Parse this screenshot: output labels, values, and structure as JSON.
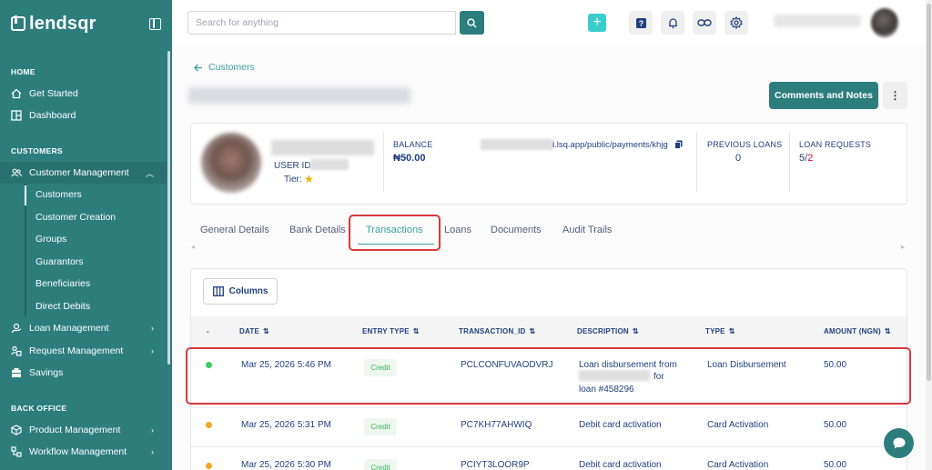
{
  "sidebar": {
    "brand": "lendsqr",
    "sections": {
      "home": "HOME",
      "customers": "CUSTOMERS",
      "back_office": "BACK OFFICE"
    },
    "items": {
      "get_started": "Get Started",
      "dashboard": "Dashboard",
      "customer_management": "Customer Management",
      "loan_management": "Loan Management",
      "request_management": "Request Management",
      "savings": "Savings",
      "product_management": "Product Management",
      "workflow_management": "Workflow Management"
    },
    "sub_items": [
      "Customers",
      "Customer Creation",
      "Groups",
      "Guarantors",
      "Beneficiaries",
      "Direct Debits"
    ]
  },
  "topbar": {
    "search_placeholder": "Search for anything",
    "plus_label": "+"
  },
  "breadcrumb": {
    "back_label": "Customers"
  },
  "actions": {
    "comments_label": "Comments and Notes",
    "more_label": "⋮"
  },
  "profile": {
    "user_id_label": "USER ID:",
    "tier_label": "Tier:",
    "tier_stars": "★",
    "balance_label": "BALANCE",
    "balance_value": "₦50.00",
    "payment_link": "i.lsq.app/public/payments/khjg",
    "previous_loans_label": "PREVIOUS LOANS",
    "previous_loans_value": "0",
    "loan_requests_label": "LOAN REQUESTS",
    "loan_requests_a": "5",
    "loan_requests_sep": "/",
    "loan_requests_b": "2"
  },
  "tabs": [
    "General Details",
    "Bank Details",
    "Transactions",
    "Loans",
    "Documents",
    "Audit Trails"
  ],
  "active_tab": "Transactions",
  "table": {
    "columns_button": "Columns",
    "headers": [
      "-",
      "DATE",
      "ENTRY TYPE",
      "TRANSACTION_ID",
      "DESCRIPTION",
      "TYPE",
      "AMOUNT (NGN)"
    ],
    "rows": [
      {
        "status_color": "#39cd62",
        "date": "Mar 25, 2026 5:46 PM",
        "entry_type": "Credit",
        "transaction_id": "PCLCONFUVAODVRJ",
        "description_line1": "Loan disbursement from",
        "description_line2": "for",
        "description_line3": "loan #458296",
        "type": "Loan Disbursement",
        "amount": "50.00"
      },
      {
        "status_color": "#f5a623",
        "date": "Mar 25, 2026 5:31 PM",
        "entry_type": "Credit",
        "transaction_id": "PC7KH77AHWIQ",
        "description_line1": "Debit card activation",
        "type": "Card Activation",
        "amount": "50.00"
      },
      {
        "status_color": "#f5a623",
        "date": "Mar 25, 2026 5:30 PM",
        "entry_type": "Credit",
        "transaction_id": "PCIYT3LOOR9P",
        "description_line1": "Debit card activation",
        "type": "Card Activation",
        "amount": "50.00"
      }
    ]
  },
  "colors": {
    "sidebar": "#2e7d7d",
    "accent": "#39cdcc",
    "highlight": "#d9393b",
    "text": "#213f7d"
  }
}
